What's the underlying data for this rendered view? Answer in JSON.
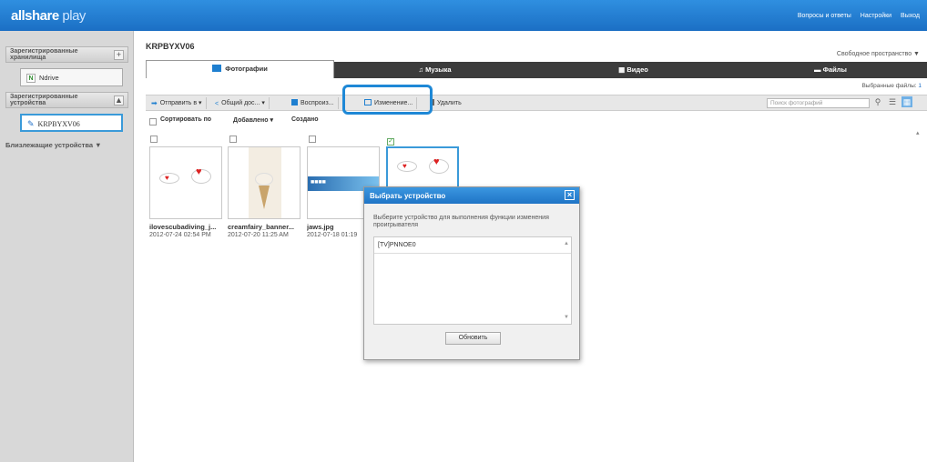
{
  "app": {
    "logo_main": "allshare",
    "logo_sub": "play"
  },
  "header": {
    "links": [
      "Вопросы и ответы",
      "Настройки",
      "Выход"
    ]
  },
  "sidebar": {
    "registered_storage": "Зарегистрированные хранилища",
    "storage_item": "Ndrive",
    "storage_badge": "N",
    "registered_devices": "Зарегистрированные устройства",
    "device_item": "KRPBYXV06",
    "nearby": "Близлежащие устройства ▼"
  },
  "main": {
    "device_title": "KRPBYXV06",
    "free_space": "Свободное пространство ▼",
    "tabs": [
      "Фотографии",
      "Музыка",
      "Видео",
      "Файлы"
    ],
    "selected_files_label": "Выбранные файлы:",
    "selected_files_count": "1",
    "toolbar": {
      "send": "Отправить в ▾",
      "share": "Общий дос... ▾",
      "play": "Воспроиз...",
      "change": "Изменение...",
      "delete": "Удалить"
    },
    "search_placeholder": "Поиск фотографий",
    "sort": {
      "sort_by": "Сортировать по",
      "added": "Добавлено ▾",
      "created": "Создано"
    },
    "files": [
      {
        "name": "ilovescubadiving_j...",
        "date": "2012-07-24 02:54 PM",
        "selected": false
      },
      {
        "name": "creamfairy_banner...",
        "date": "2012-07-20 11:25 AM",
        "selected": false
      },
      {
        "name": "jaws.jpg",
        "date": "2012-07-18 01:19",
        "selected": false
      },
      {
        "name": "",
        "date": "",
        "selected": true
      }
    ]
  },
  "dialog": {
    "title": "Выбрать устройство",
    "text": "Выберите устройство для выполнения функции изменения проигрывателя",
    "devices": [
      "[TV]PNNOE0"
    ],
    "refresh": "Обновить"
  },
  "colors": {
    "header": "#1b6fc4",
    "accent": "#1e88d6",
    "tab_bar": "#3c3c3c"
  }
}
